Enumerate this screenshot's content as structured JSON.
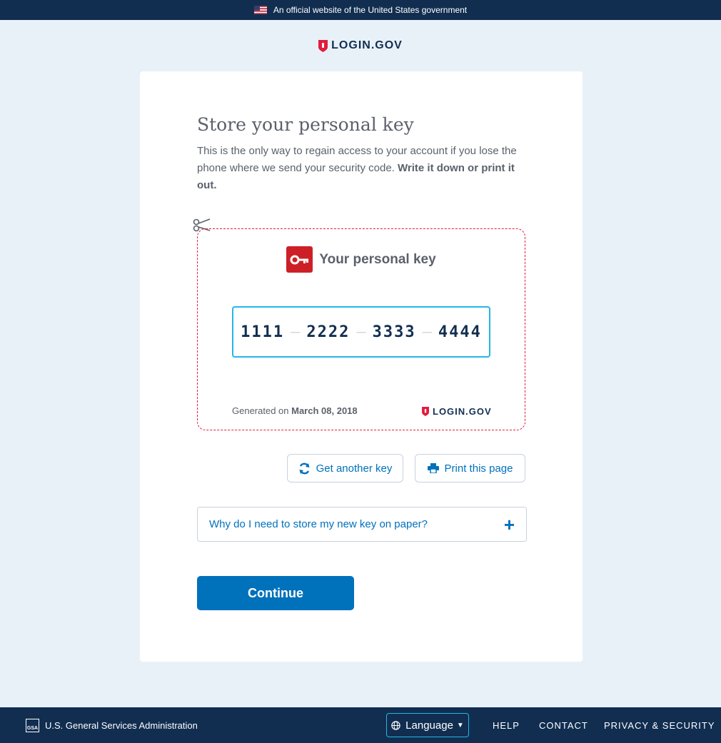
{
  "banner": {
    "text": "An official website of the United States government",
    "flag_icon": "us-flag-icon"
  },
  "header": {
    "logo_text": "LOGIN.GOV",
    "logo_icon": "shield-icon"
  },
  "page": {
    "title": "Store your personal key",
    "intro_text": "This is the only way to regain access to your account if you lose the phone where we send your security code. ",
    "intro_bold": "Write it down or print it out."
  },
  "key_card": {
    "heading": "Your personal key",
    "heading_icon": "key-icon",
    "cut_icon": "scissors-icon",
    "code_segments": [
      "1111",
      "2222",
      "3333",
      "4444"
    ],
    "generated_label": "Generated on ",
    "generated_date": "March 08, 2018",
    "logo_text": "LOGIN.GOV"
  },
  "actions": {
    "get_another_key": "Get another key",
    "get_another_key_icon": "refresh-icon",
    "print_page": "Print this page",
    "print_page_icon": "printer-icon"
  },
  "accordion": {
    "question": "Why do I need to store my new key on paper?",
    "toggle_icon": "plus-icon",
    "toggle_glyph": "+"
  },
  "continue_label": "Continue",
  "footer": {
    "agency": "U.S. General Services Administration",
    "agency_logo": "GSA",
    "language_label": "Language",
    "help": "HELP",
    "contact": "CONTACT",
    "privacy": "PRIVACY & SECURITY"
  },
  "colors": {
    "navy": "#112e51",
    "link_blue": "#0071bb",
    "accent_red": "#e21c3d",
    "code_border": "#26b6e6",
    "page_background": "#e9f1f8"
  }
}
